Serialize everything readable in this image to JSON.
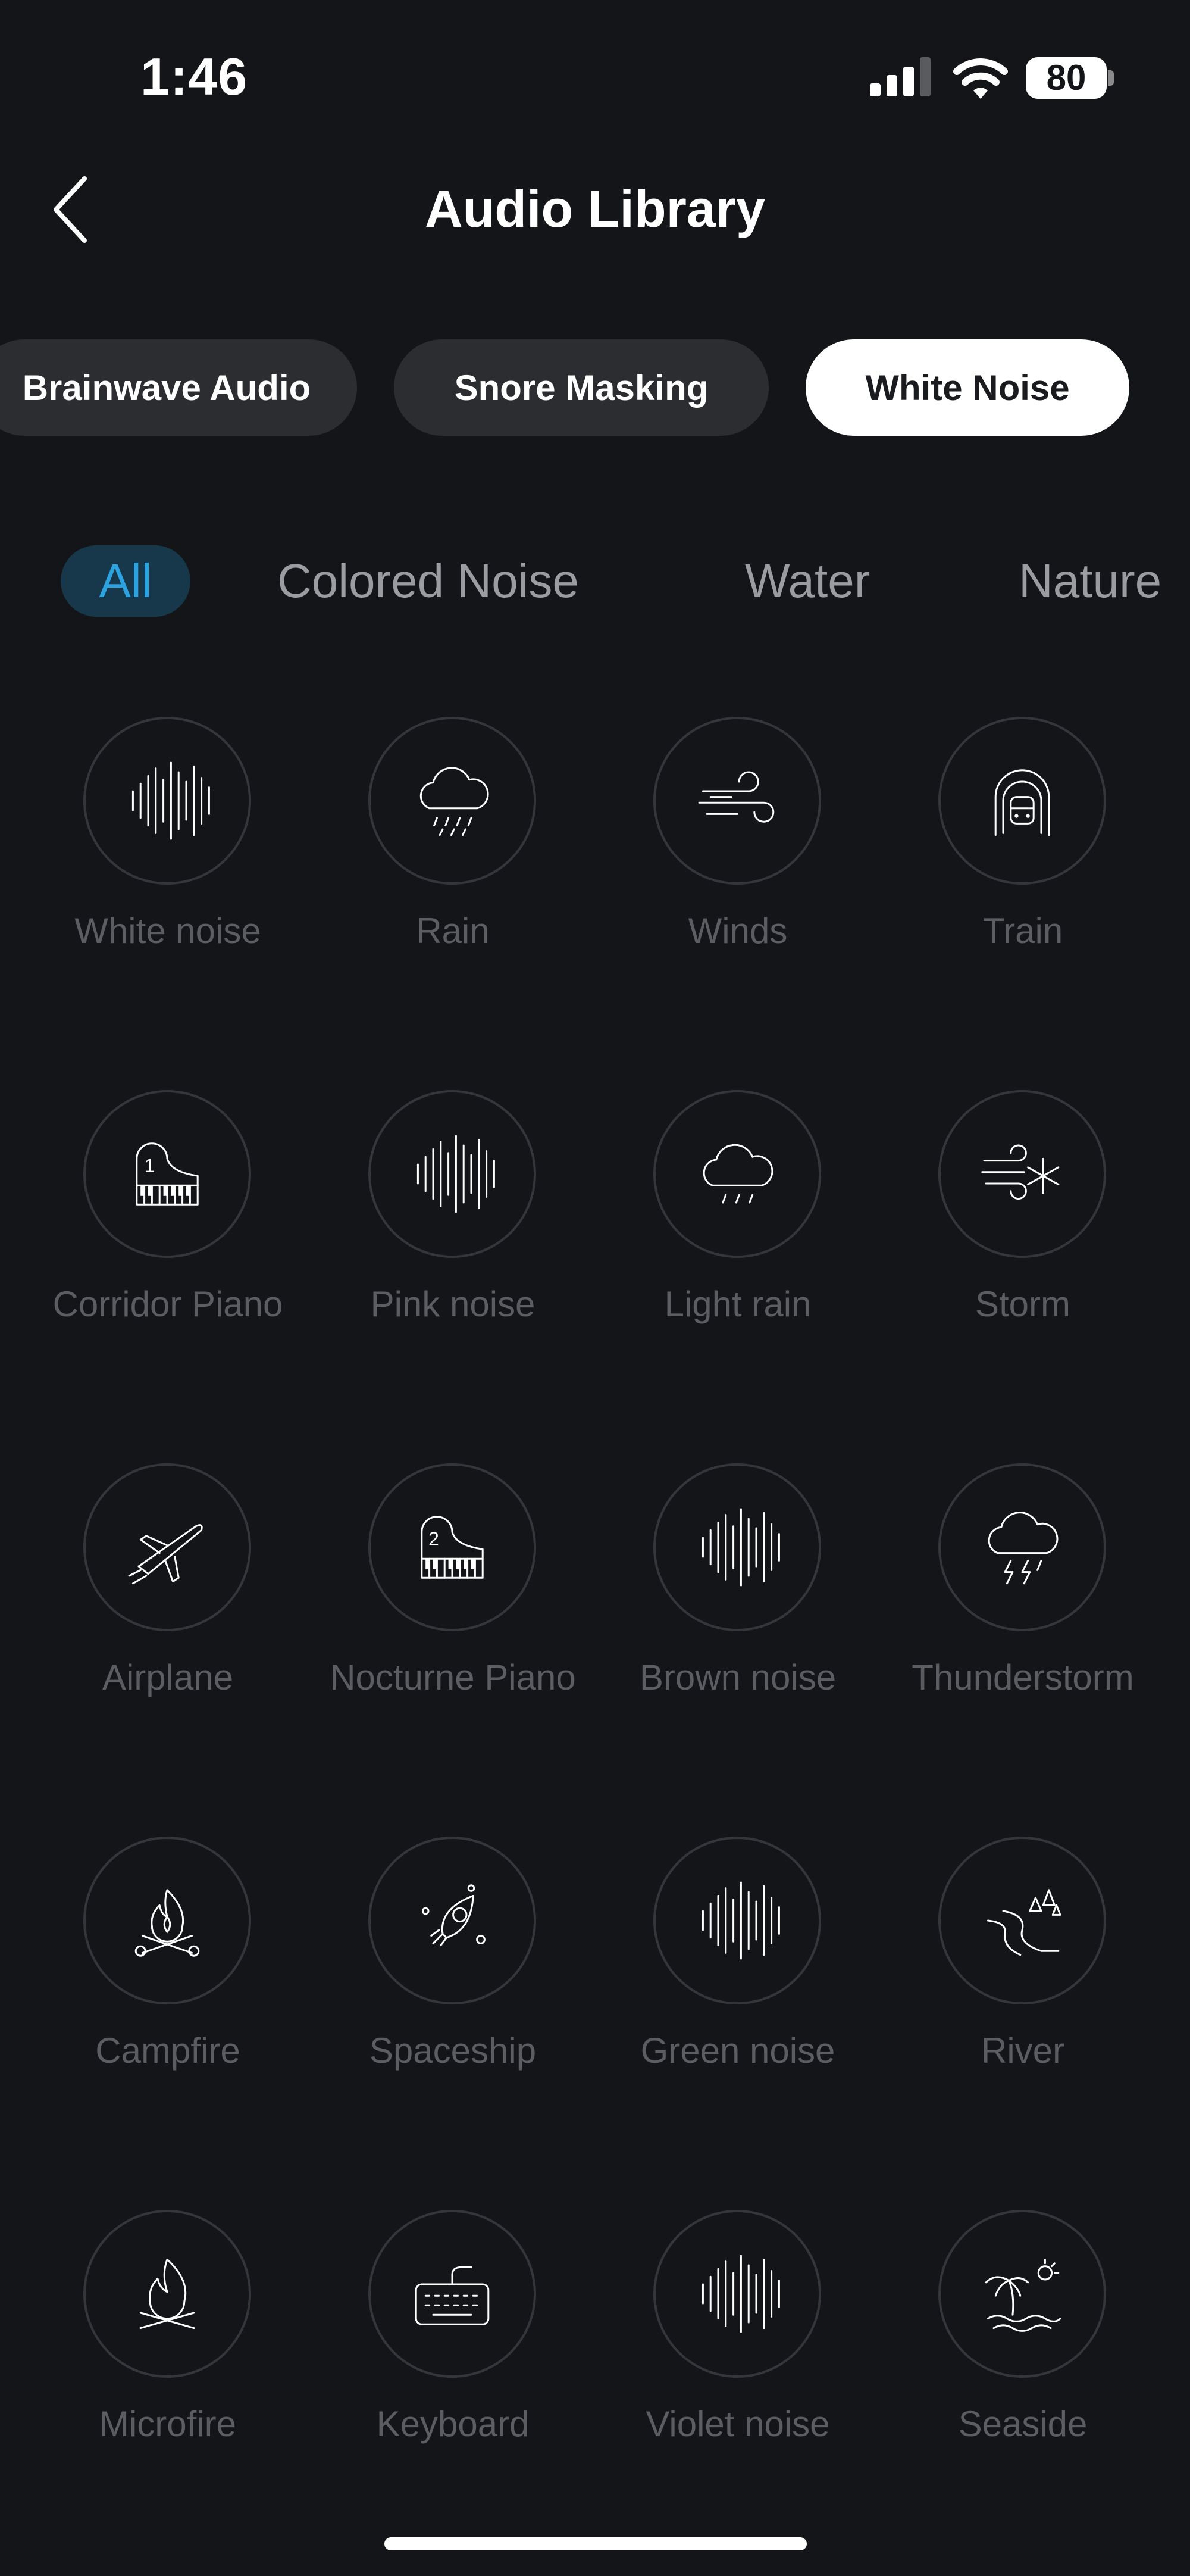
{
  "status": {
    "time": "1:46",
    "battery": "80"
  },
  "header": {
    "title": "Audio Library"
  },
  "segments": [
    {
      "label": "Brainwave Audio"
    },
    {
      "label": "Snore Masking"
    },
    {
      "label": "White Noise"
    }
  ],
  "filters": [
    {
      "label": "All"
    },
    {
      "label": "Colored Noise"
    },
    {
      "label": "Water"
    },
    {
      "label": "Nature"
    }
  ],
  "sounds": [
    {
      "label": "White noise",
      "icon": "soundwave-icon"
    },
    {
      "label": "Rain",
      "icon": "rain-cloud-icon"
    },
    {
      "label": "Winds",
      "icon": "wind-icon"
    },
    {
      "label": "Train",
      "icon": "train-icon"
    },
    {
      "label": "Corridor Piano",
      "icon": "piano-1-icon"
    },
    {
      "label": "Pink noise",
      "icon": "soundwave-icon"
    },
    {
      "label": "Light rain",
      "icon": "light-rain-cloud-icon"
    },
    {
      "label": "Storm",
      "icon": "storm-wind-snow-icon"
    },
    {
      "label": "Airplane",
      "icon": "airplane-icon"
    },
    {
      "label": "Nocturne Piano",
      "icon": "piano-2-icon"
    },
    {
      "label": "Brown noise",
      "icon": "soundwave-icon"
    },
    {
      "label": "Thunderstorm",
      "icon": "thunder-cloud-icon"
    },
    {
      "label": "Campfire",
      "icon": "campfire-icon"
    },
    {
      "label": "Spaceship",
      "icon": "rocket-icon"
    },
    {
      "label": "Green noise",
      "icon": "soundwave-icon"
    },
    {
      "label": "River",
      "icon": "river-icon"
    },
    {
      "label": "Microfire",
      "icon": "fire-icon"
    },
    {
      "label": "Keyboard",
      "icon": "keyboard-icon"
    },
    {
      "label": "Violet noise",
      "icon": "soundwave-icon"
    },
    {
      "label": "Seaside",
      "icon": "palm-beach-icon"
    }
  ]
}
